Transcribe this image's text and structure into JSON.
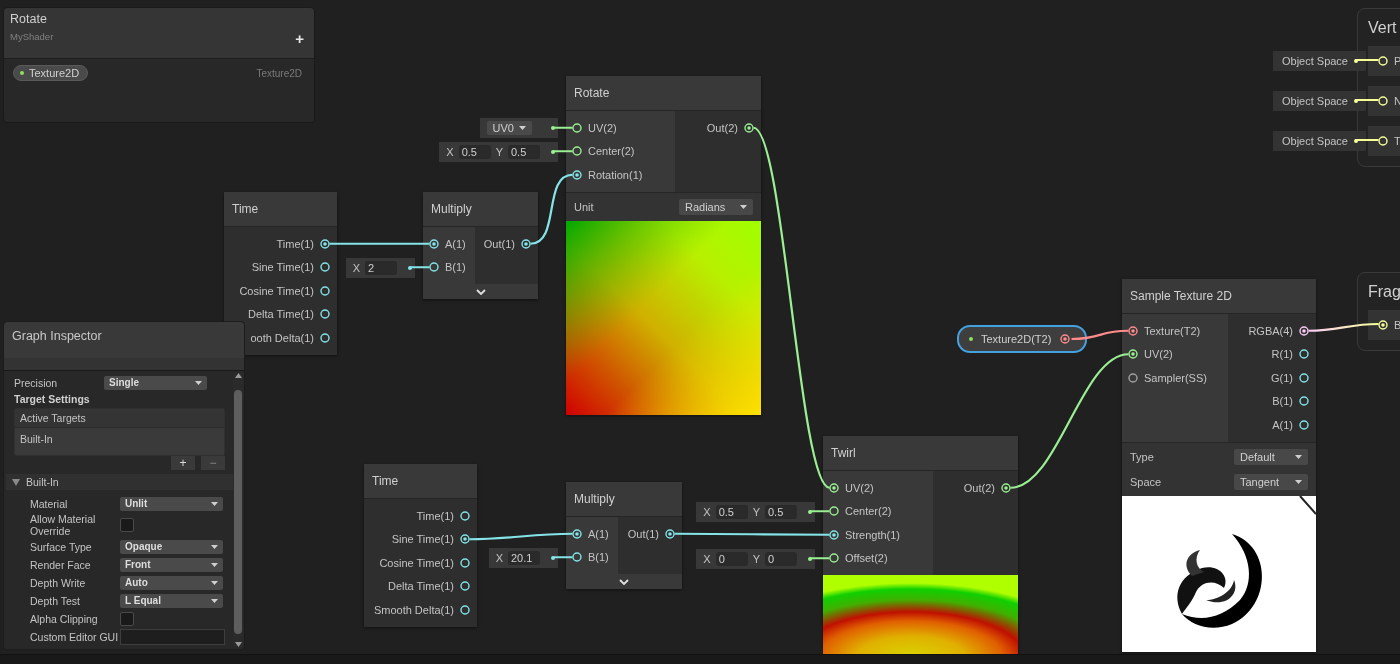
{
  "blackboard": {
    "title": "Rotate",
    "subtitle": "MyShader",
    "add_label": "+",
    "properties": [
      {
        "name": "Texture2D",
        "type_label": "Texture2D"
      }
    ]
  },
  "nodes": [
    {
      "title": "Time",
      "outputs": [
        {
          "label": "Time(1)",
          "kind": "float",
          "connected": true
        },
        {
          "label": "Sine Time(1)",
          "kind": "float",
          "connected": false
        },
        {
          "label": "Cosine Time(1)",
          "kind": "float",
          "connected": false
        },
        {
          "label": "Delta Time(1)",
          "kind": "float",
          "connected": false
        },
        {
          "label": "ooth Delta(1)",
          "kind": "float",
          "connected": false
        }
      ]
    },
    {
      "title": "Multiply",
      "inputs": [
        {
          "label": "A(1)",
          "kind": "float",
          "connected": true
        },
        {
          "label": "B(1)",
          "kind": "float",
          "connected": false,
          "default": {
            "kind": "vector",
            "fields": [
              {
                "axis": "X",
                "value": "2"
              }
            ]
          }
        }
      ],
      "outputs": [
        {
          "label": "Out(1)",
          "kind": "float",
          "connected": true
        }
      ],
      "expandable": true
    },
    {
      "title": "Rotate",
      "inputs": [
        {
          "label": "UV(2)",
          "kind": "vector2",
          "connected": false,
          "default": {
            "kind": "dropdown",
            "value": "UV0"
          }
        },
        {
          "label": "Center(2)",
          "kind": "vector2",
          "connected": false,
          "default": {
            "kind": "vector",
            "fields": [
              {
                "axis": "X",
                "value": "0.5"
              },
              {
                "axis": "Y",
                "value": "0.5"
              }
            ]
          }
        },
        {
          "label": "Rotation(1)",
          "kind": "float",
          "connected": true
        }
      ],
      "outputs": [
        {
          "label": "Out(2)",
          "kind": "vector2",
          "connected": true
        }
      ],
      "settings": [
        {
          "label": "Unit",
          "value": "Radians"
        }
      ],
      "preview": {
        "kind": "rotate"
      }
    },
    {
      "title": "Time",
      "outputs": [
        {
          "label": "Time(1)",
          "kind": "float",
          "connected": false
        },
        {
          "label": "Sine Time(1)",
          "kind": "float",
          "connected": true
        },
        {
          "label": "Cosine Time(1)",
          "kind": "float",
          "connected": false
        },
        {
          "label": "Delta Time(1)",
          "kind": "float",
          "connected": false
        },
        {
          "label": "Smooth Delta(1)",
          "kind": "float",
          "connected": false
        }
      ]
    },
    {
      "title": "Multiply",
      "inputs": [
        {
          "label": "A(1)",
          "kind": "float",
          "connected": true
        },
        {
          "label": "B(1)",
          "kind": "float",
          "connected": false,
          "default": {
            "kind": "vector",
            "fields": [
              {
                "axis": "X",
                "value": "20.1"
              }
            ]
          }
        }
      ],
      "outputs": [
        {
          "label": "Out(1)",
          "kind": "float",
          "connected": true
        }
      ],
      "expandable": true
    },
    {
      "title": "Twirl",
      "inputs": [
        {
          "label": "UV(2)",
          "kind": "vector2",
          "connected": true
        },
        {
          "label": "Center(2)",
          "kind": "vector2",
          "connected": false,
          "default": {
            "kind": "vector",
            "fields": [
              {
                "axis": "X",
                "value": "0.5"
              },
              {
                "axis": "Y",
                "value": "0.5"
              }
            ]
          }
        },
        {
          "label": "Strength(1)",
          "kind": "float",
          "connected": true
        },
        {
          "label": "Offset(2)",
          "kind": "vector2",
          "connected": false,
          "default": {
            "kind": "vector",
            "fields": [
              {
                "axis": "X",
                "value": "0"
              },
              {
                "axis": "Y",
                "value": "0"
              }
            ]
          }
        }
      ],
      "outputs": [
        {
          "label": "Out(2)",
          "kind": "vector2",
          "connected": true
        }
      ],
      "preview": {
        "kind": "twirl"
      }
    },
    {
      "title": "Sample Texture 2D",
      "inputs": [
        {
          "label": "Texture(T2)",
          "kind": "texture",
          "connected": true
        },
        {
          "label": "UV(2)",
          "kind": "vector2",
          "connected": true
        },
        {
          "label": "Sampler(SS)",
          "kind": "sampler",
          "connected": false
        }
      ],
      "outputs": [
        {
          "label": "RGBA(4)",
          "kind": "vector4",
          "connected": true
        },
        {
          "label": "R(1)",
          "kind": "float",
          "connected": false
        },
        {
          "label": "G(1)",
          "kind": "float",
          "connected": false
        },
        {
          "label": "B(1)",
          "kind": "float",
          "connected": false
        },
        {
          "label": "A(1)",
          "kind": "float",
          "connected": false
        }
      ],
      "settings": [
        {
          "label": "Type",
          "value": "Default"
        },
        {
          "label": "Space",
          "value": "Tangent"
        }
      ],
      "preview": {
        "kind": "texture"
      }
    }
  ],
  "property_node": {
    "label": "Texture2D(T2)",
    "kind": "texture",
    "connected": true,
    "selected": true
  },
  "stacks": [
    {
      "title": "Vert",
      "blocks": [
        {
          "label": "P",
          "kind": "vector3",
          "connected": false,
          "default": {
            "kind": "space",
            "value": "Object Space"
          }
        },
        {
          "label": "N",
          "kind": "vector3",
          "connected": false,
          "default": {
            "kind": "space",
            "value": "Object Space"
          }
        },
        {
          "label": "T",
          "kind": "vector3",
          "connected": false,
          "default": {
            "kind": "space",
            "value": "Object Space"
          }
        }
      ]
    },
    {
      "title": "Frag",
      "blocks": [
        {
          "label": "B",
          "kind": "vector3",
          "connected": true
        }
      ]
    }
  ],
  "inspector": {
    "title": "Graph Inspector",
    "top_fields": [
      {
        "kind": "dropdown",
        "label": "Precision",
        "value": "Single"
      }
    ],
    "targets_heading": "Target Settings",
    "targets": {
      "header": "Active Targets",
      "items": [
        "Built-In"
      ],
      "add_label": "+",
      "remove_label": "−"
    },
    "section": {
      "title": "Built-In",
      "expanded": true,
      "fields": [
        {
          "kind": "dropdown",
          "label": "Material",
          "value": "Unlit"
        },
        {
          "kind": "checkbox",
          "label": "Allow Material Override",
          "checked": false
        },
        {
          "kind": "dropdown",
          "label": "Surface Type",
          "value": "Opaque"
        },
        {
          "kind": "dropdown",
          "label": "Render Face",
          "value": "Front"
        },
        {
          "kind": "dropdown",
          "label": "Depth Write",
          "value": "Auto"
        },
        {
          "kind": "dropdown",
          "label": "Depth Test",
          "value": "L Equal"
        },
        {
          "kind": "checkbox",
          "label": "Alpha Clipping",
          "checked": false
        },
        {
          "kind": "text",
          "label": "Custom Editor GUI"
        }
      ]
    }
  }
}
